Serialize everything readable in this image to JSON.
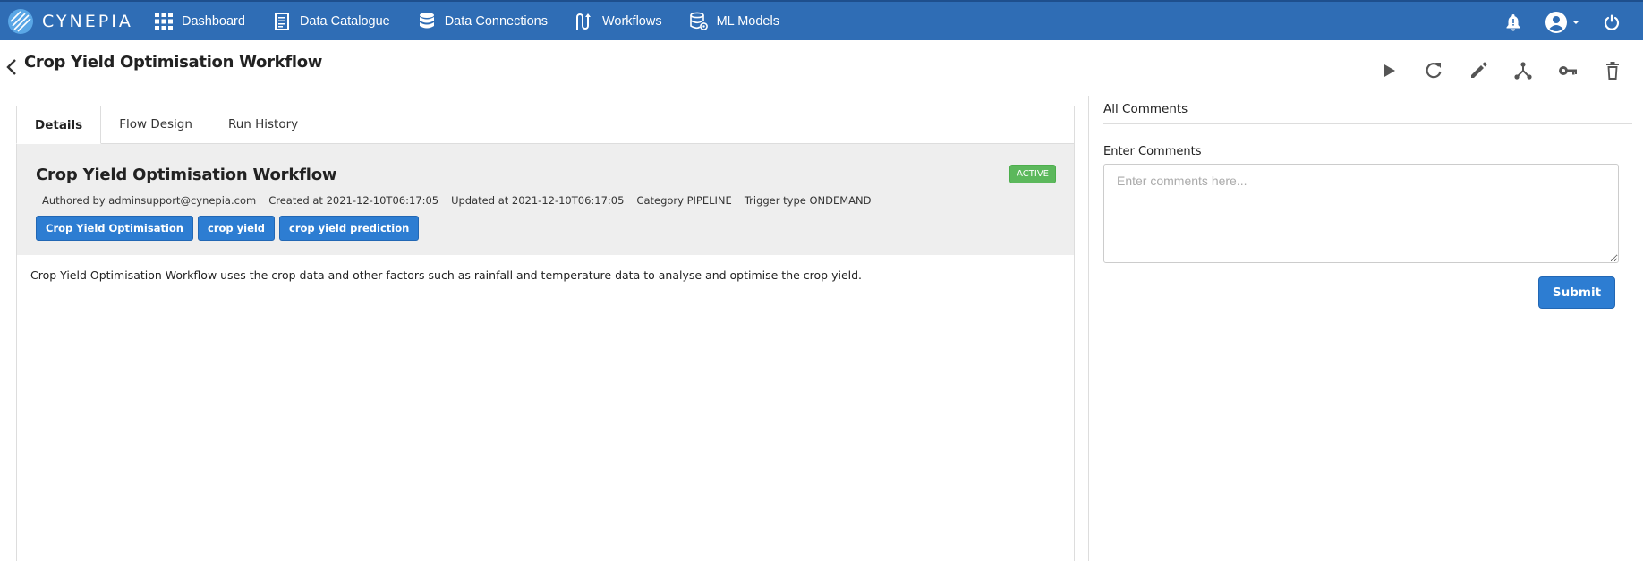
{
  "brand": {
    "name": "CYNEPIA",
    "logo_icon": "cynepia-logo-icon"
  },
  "nav": {
    "items": [
      {
        "label": "Dashboard",
        "icon": "grid-icon"
      },
      {
        "label": "Data Catalogue",
        "icon": "document-list-icon"
      },
      {
        "label": "Data Connections",
        "icon": "database-icon"
      },
      {
        "label": "Workflows",
        "icon": "workflow-icon"
      },
      {
        "label": "ML Models",
        "icon": "database-settings-icon"
      }
    ],
    "right_icons": [
      "notification-bell-icon",
      "user-account-icon",
      "power-icon"
    ]
  },
  "page": {
    "title": "Crop Yield Optimisation Workflow",
    "actions": [
      "run-icon",
      "refresh-icon",
      "edit-icon",
      "fork-icon",
      "key-icon",
      "delete-icon"
    ]
  },
  "tabs": [
    {
      "label": "Details",
      "active": true
    },
    {
      "label": "Flow Design",
      "active": false
    },
    {
      "label": "Run History",
      "active": false
    }
  ],
  "workflow": {
    "title": "Crop Yield Optimisation Workflow",
    "status": "ACTIVE",
    "authored": "Authored by adminsupport@cynepia.com",
    "created": "Created at 2021-12-10T06:17:05",
    "updated": "Updated at 2021-12-10T06:17:05",
    "category": "Category PIPELINE",
    "trigger": "Trigger type ONDEMAND",
    "tags": [
      "Crop Yield Optimisation",
      "crop yield",
      "crop yield prediction"
    ],
    "description": "Crop Yield Optimisation Workflow uses the crop data  and other factors such as rainfall and temperature data to analyse and optimise the crop yield."
  },
  "comments": {
    "title": "All Comments",
    "label": "Enter Comments",
    "placeholder": "Enter comments here...",
    "value": "",
    "submit_label": "Submit"
  },
  "colors": {
    "nav_bg": "#2f6db5",
    "accent": "#2d7dd2",
    "active": "#5cb85c",
    "panel_bg": "#eeeeee"
  }
}
